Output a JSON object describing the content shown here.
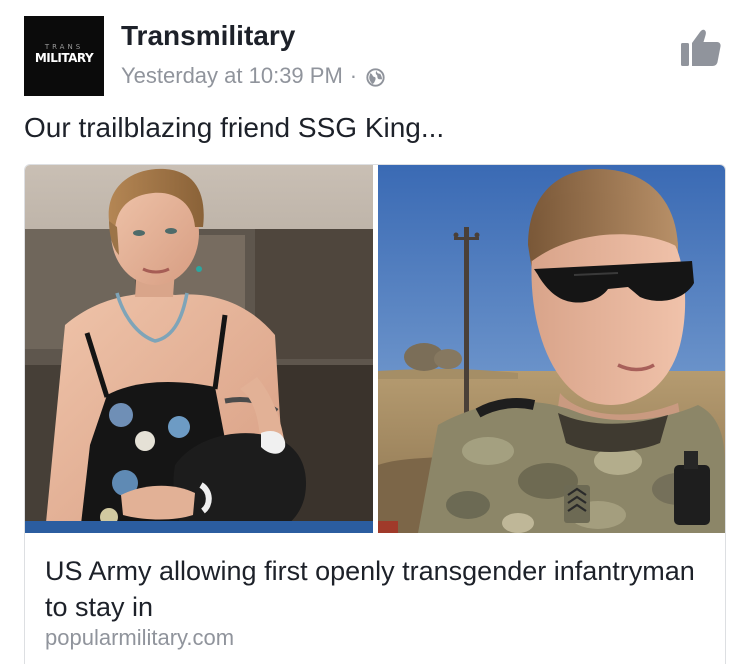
{
  "post": {
    "author": {
      "name": "Transmilitary",
      "avatar_text_top": "TRANS",
      "avatar_text_main": "MILITARY"
    },
    "timestamp": "Yesterday at 10:39 PM",
    "separator": "·",
    "privacy_icon": "globe-icon",
    "like_icon": "thumbs-up-icon",
    "message": "Our trailblazing friend SSG King..."
  },
  "link_preview": {
    "title": "US Army allowing first openly transgender infantryman to stay in",
    "domain": "popularmilitary.com"
  },
  "colors": {
    "text_primary": "#1d2129",
    "text_secondary": "#90949c",
    "card_border": "#dddfe2",
    "avatar_bg": "#0b0b0b"
  }
}
